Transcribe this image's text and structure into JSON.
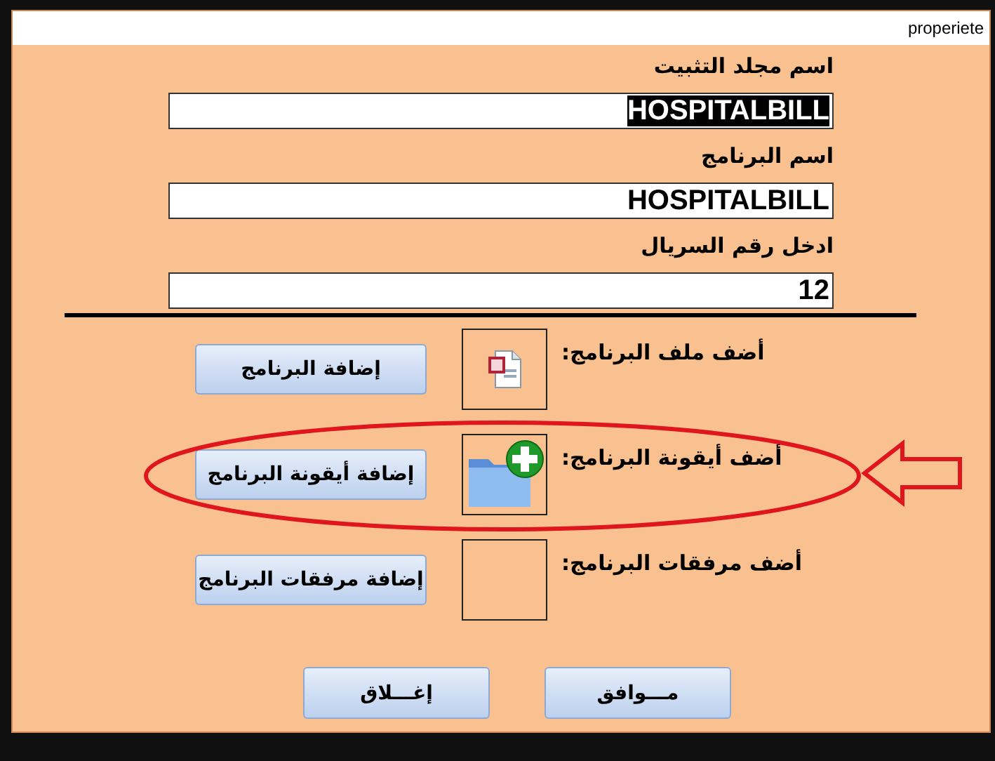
{
  "window": {
    "title": "properiete"
  },
  "fields": [
    {
      "label": "اسم مجلد التثبيت",
      "value": "HOSPITALBILL",
      "text_selected": true
    },
    {
      "label": "اسم البرنامج",
      "value": "HOSPITALBILL",
      "text_selected": false
    },
    {
      "label": "ادخل رقم السريال",
      "value": "12",
      "text_selected": false
    }
  ],
  "attachments": [
    {
      "label": "أضف ملف البرنامج:",
      "kind": "document",
      "button": "إضافة البرنامج",
      "highlighted": false
    },
    {
      "label": "أضف أيقونة البرنامج:",
      "kind": "folder-add",
      "button": "إضافة أيقونة البرنامج",
      "highlighted": true
    },
    {
      "label": "أضف مرفقات البرنامج:",
      "kind": "empty",
      "button": "إضافة مرفقات البرنامج",
      "highlighted": false
    }
  ],
  "buttons": [
    "مـــوافق",
    "إغـــلاق"
  ]
}
